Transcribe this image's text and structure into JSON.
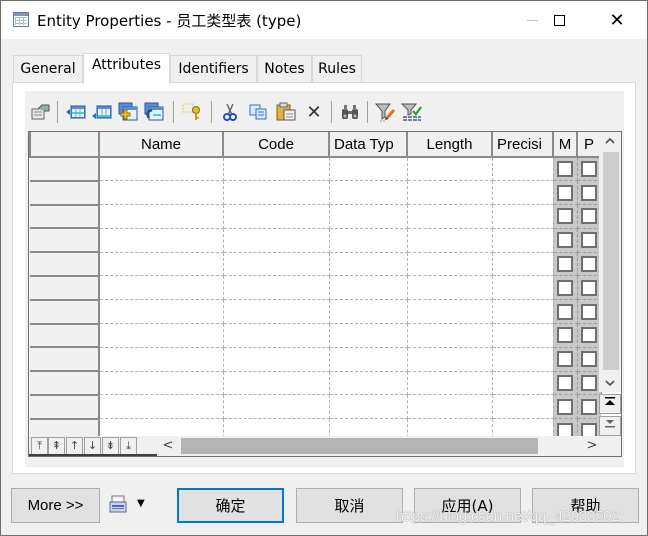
{
  "window": {
    "title": "Entity Properties - 员工类型表 (type)",
    "icon": "table-icon",
    "controls": {
      "minimize": "minimize-icon",
      "maximize": "maximize-icon",
      "close": "✕"
    }
  },
  "tabs": [
    {
      "label": "General",
      "active": false
    },
    {
      "label": "Attributes",
      "active": true
    },
    {
      "label": "Identifiers",
      "active": false
    },
    {
      "label": "Notes",
      "active": false
    },
    {
      "label": "Rules",
      "active": false
    }
  ],
  "toolbar": {
    "buttons": [
      {
        "name": "properties",
        "icon": "properties-icon"
      },
      {
        "name": "insert-row",
        "icon": "insert-row-icon"
      },
      {
        "name": "add-row",
        "icon": "add-row-icon"
      },
      {
        "name": "add-attributes",
        "icon": "add-attributes-icon"
      },
      {
        "name": "reuse-attributes",
        "icon": "reuse-attributes-icon"
      },
      {
        "name": "key",
        "icon": "key-icon"
      },
      {
        "name": "cut",
        "icon": "scissors-icon"
      },
      {
        "name": "copy",
        "icon": "copy-icon"
      },
      {
        "name": "paste",
        "icon": "paste-icon"
      },
      {
        "name": "delete",
        "icon": "delete-icon",
        "glyph": "✕"
      },
      {
        "name": "find",
        "icon": "binoculars-icon"
      },
      {
        "name": "customize-filter",
        "icon": "filter-edit-icon"
      },
      {
        "name": "enable-filter",
        "icon": "filter-check-icon"
      }
    ]
  },
  "grid": {
    "columns": [
      "",
      "Name",
      "Code",
      "Data Typ",
      "Length",
      "Precisi",
      "M",
      "P"
    ],
    "row_count": 12,
    "rows_mandatory": [
      false,
      false,
      false,
      false,
      false,
      false,
      false,
      false,
      false,
      false,
      false,
      false
    ],
    "rows_primary": [
      false,
      false,
      false,
      false,
      false,
      false,
      false,
      false,
      false,
      false,
      false,
      false
    ],
    "scroll_up": "^",
    "scroll_down": "v",
    "nav_top": "⤒",
    "nav_bottom": "⤓",
    "row_nav": [
      "⤒",
      "⇞",
      "↑",
      "↓",
      "⇟",
      "⤓"
    ],
    "hscroll_left": "<",
    "hscroll_right": ">"
  },
  "footer": {
    "more": "More >>",
    "print_icon": "print-icon",
    "dropdown": "▼",
    "ok": "确定",
    "cancel": "取消",
    "apply": "应用(A)",
    "help": "帮助"
  },
  "watermark": "https://blog.csdn.net/qq_42983502"
}
